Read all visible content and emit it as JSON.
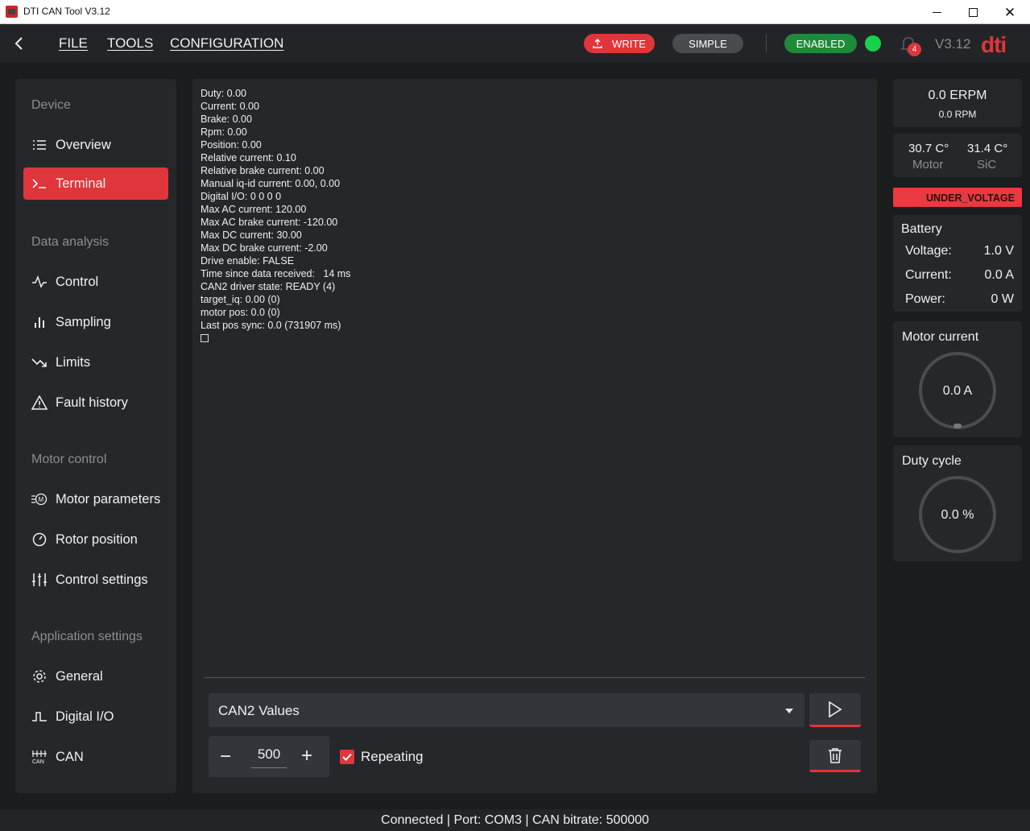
{
  "window": {
    "title": "DTI CAN Tool V3.12"
  },
  "header": {
    "menu": [
      "FILE",
      "TOOLS",
      "CONFIGURATION"
    ],
    "write_label": "WRITE",
    "simple_label": "SIMPLE",
    "enabled_label": "ENABLED",
    "notification_count": "4",
    "version": "V3.12",
    "logo_text": "dti",
    "colors": {
      "accent": "#e0363b",
      "enabled": "#1f8a3a",
      "status_dot": "#16d24a"
    }
  },
  "sidebar": {
    "sections": {
      "device": "Device",
      "data_analysis": "Data analysis",
      "motor_control": "Motor control",
      "application_settings": "Application settings"
    },
    "items": [
      {
        "label": "Overview",
        "icon": "list-icon"
      },
      {
        "label": "Terminal",
        "icon": "terminal-icon",
        "active": true
      },
      {
        "label": "Control",
        "icon": "pulse-icon"
      },
      {
        "label": "Sampling",
        "icon": "bar-chart-icon"
      },
      {
        "label": "Limits",
        "icon": "trend-down-icon"
      },
      {
        "label": "Fault history",
        "icon": "warning-icon"
      },
      {
        "label": "Motor parameters",
        "icon": "motor-icon"
      },
      {
        "label": "Rotor position",
        "icon": "gauge-icon"
      },
      {
        "label": "Control settings",
        "icon": "sliders-icon"
      },
      {
        "label": "General",
        "icon": "gear-icon"
      },
      {
        "label": "Digital I/O",
        "icon": "pulse-square-icon"
      },
      {
        "label": "CAN",
        "icon": "can-bus-icon"
      }
    ]
  },
  "terminal": {
    "lines": [
      "Duty: 0.00",
      "Current: 0.00",
      "Brake: 0.00",
      "Rpm: 0.00",
      "Position: 0.00",
      "Relative current: 0.10",
      "Relative brake current: 0.00",
      "Manual iq-id current: 0.00, 0.00",
      "Digital I/O: 0 0 0 0",
      "Max AC current: 120.00",
      "Max AC brake current: -120.00",
      "Max DC current: 30.00",
      "Max DC brake current: -2.00",
      "Drive enable: FALSE",
      "Time since data received:   14 ms",
      "CAN2 driver state: READY (4)",
      "target_iq: 0.00 (0)",
      "motor pos: 0.0 (0)",
      "Last pos sync: 0.0 (731907 ms)"
    ],
    "command_selected": "CAN2 Values",
    "interval_value": "500",
    "repeating_label": "Repeating",
    "repeating_checked": true
  },
  "right_panel": {
    "erpm": "0.0 ERPM",
    "rpm": "0.0 RPM",
    "motor_temp": "30.7 C°",
    "motor_temp_label": "Motor",
    "sic_temp": "31.4 C°",
    "sic_temp_label": "SiC",
    "fault": "UNDER_VOLTAGE",
    "battery": {
      "title": "Battery",
      "voltage_label": "Voltage:",
      "voltage": "1.0 V",
      "current_label": "Current:",
      "current": "0.0 A",
      "power_label": "Power:",
      "power": "0 W"
    },
    "motor_current": {
      "title": "Motor current",
      "value": "0.0 A"
    },
    "duty_cycle": {
      "title": "Duty cycle",
      "value": "0.0 %"
    }
  },
  "statusbar": {
    "text": "Connected | Port: COM3 | CAN bitrate: 500000"
  }
}
